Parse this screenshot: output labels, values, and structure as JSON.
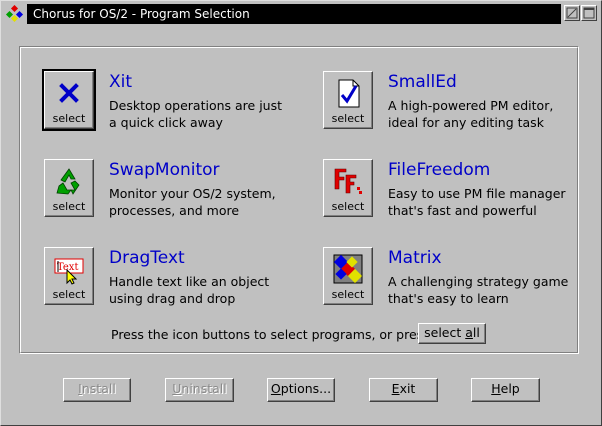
{
  "window": {
    "title": "Chorus for OS/2 - Program Selection"
  },
  "programs": [
    {
      "name": "Xit",
      "desc1": "Desktop operations are just",
      "desc2": "a quick click away",
      "button": "select",
      "icon": "x-icon"
    },
    {
      "name": "SmallEd",
      "desc1": "A high-powered PM editor,",
      "desc2": "ideal for any editing task",
      "button": "select",
      "icon": "document-check-icon"
    },
    {
      "name": "SwapMonitor",
      "desc1": "Monitor your OS/2 system,",
      "desc2": "processes, and more",
      "button": "select",
      "icon": "recycle-icon"
    },
    {
      "name": "FileFreedom",
      "desc1": "Easy to use PM file manager",
      "desc2": "that's fast and powerful",
      "button": "select",
      "icon": "ff-logo-icon"
    },
    {
      "name": "DragText",
      "desc1": "Handle text like an object",
      "desc2": "using drag and drop",
      "button": "select",
      "icon": "text-cursor-icon"
    },
    {
      "name": "Matrix",
      "desc1": "A challenging strategy game",
      "desc2": "that's easy to learn",
      "button": "select",
      "icon": "diamond-grid-icon"
    }
  ],
  "hint": "Press the icon buttons to select programs, or press",
  "select_all": {
    "pre": "select ",
    "accel": "a",
    "post": "ll"
  },
  "buttons": {
    "install": {
      "pre": "",
      "accel": "I",
      "post": "nstall"
    },
    "uninstall": {
      "pre": "",
      "accel": "U",
      "post": "ninstall"
    },
    "options": {
      "pre": "",
      "accel": "O",
      "post": "ptions..."
    },
    "exit": {
      "pre": "",
      "accel": "E",
      "post": "xit"
    },
    "help": {
      "pre": "",
      "accel": "H",
      "post": "elp"
    }
  },
  "colors": {
    "title_bg": "#000000",
    "title_fg": "#ffffff",
    "face": "#c0c0c0",
    "prog_name": "#0000c8"
  }
}
